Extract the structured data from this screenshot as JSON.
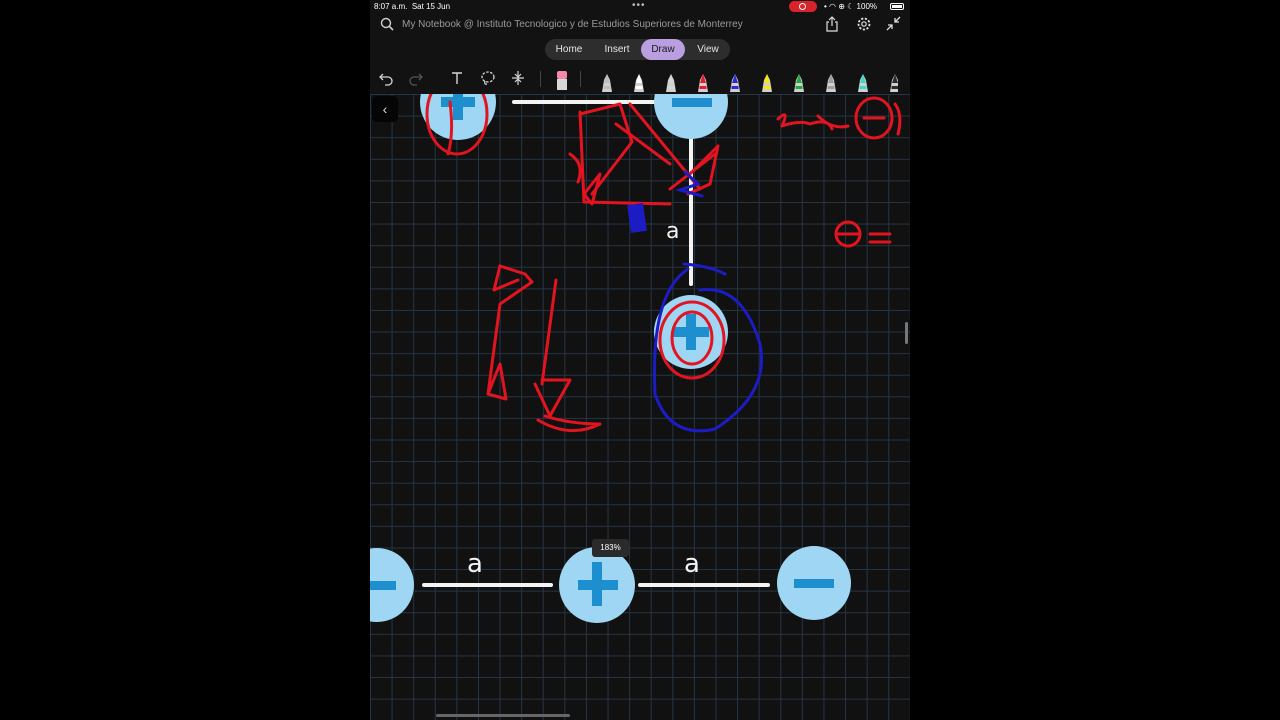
{
  "status_bar": {
    "time": "8:07 a.m.",
    "date": "Sat 15 Jun",
    "battery": "100%"
  },
  "title_bar": {
    "notebook_title": "My Notebook @ Instituto Tecnologico y de Estudios Superiores de Monterrey"
  },
  "tabs": [
    {
      "label": "Home",
      "active": false
    },
    {
      "label": "Insert",
      "active": false
    },
    {
      "label": "Draw",
      "active": true
    },
    {
      "label": "View",
      "active": false
    }
  ],
  "toolbar": {
    "tools": [
      "undo-icon",
      "redo-icon",
      "text-icon",
      "lasso-icon",
      "insert-space-icon",
      "eraser-icon"
    ],
    "pens": [
      {
        "color": "#bdbdbd"
      },
      {
        "color": "#ffffff"
      },
      {
        "color": "#cfd8dc"
      },
      {
        "color": "#e8192c"
      },
      {
        "color": "#2a2ad0"
      },
      {
        "color": "#ffe600"
      },
      {
        "color": "#1faa3a"
      },
      {
        "color": "#9e9e9e"
      },
      {
        "color": "#3fd9c7"
      },
      {
        "color": "#2b2b2b"
      }
    ]
  },
  "canvas": {
    "labels": {
      "top_a": "a",
      "bottom_a_left": "a",
      "bottom_a_right": "a"
    },
    "ink_colors": {
      "red": "#e2141f",
      "blue": "#1c1cc4"
    },
    "charge_color": "#9fd6f4",
    "sign_color": "#1d8fce"
  },
  "zoom_level": "183%"
}
